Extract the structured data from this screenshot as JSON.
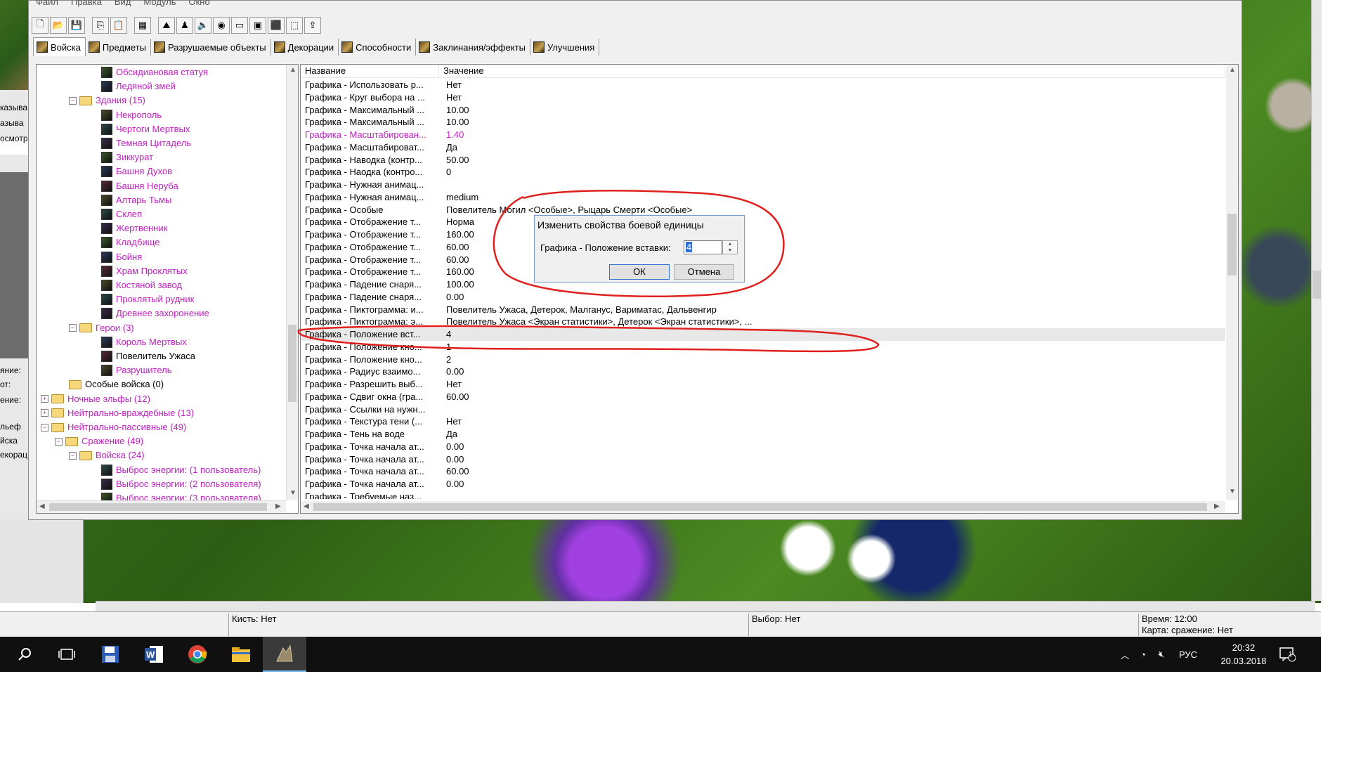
{
  "menu": [
    "Файл",
    "Правка",
    "Вид",
    "Модуль",
    "Окно"
  ],
  "toolbar_icons": [
    "new-file-icon",
    "open-folder-icon",
    "save-icon",
    "copy-icon",
    "paste-icon",
    "select-icon",
    "terrain-icon",
    "unit-icon",
    "sound-icon",
    "object-editor-icon",
    "trigger-icon",
    "import-icon",
    "script-icon",
    "ai-icon",
    "test-map-icon"
  ],
  "tabs": [
    "Войска",
    "Предметы",
    "Разрушаемые объекты",
    "Декорации",
    "Способности",
    "Заклинания/эффекты",
    "Улучшения"
  ],
  "tree": [
    {
      "label": "Обсидиановая статуя",
      "level": 3,
      "kind": "unit",
      "color": "mag"
    },
    {
      "label": "Ледяной змей",
      "level": 3,
      "kind": "unit",
      "color": "mag"
    },
    {
      "label": "Здания (15)",
      "level": 2,
      "kind": "folder",
      "color": "mag",
      "pm": "−"
    },
    {
      "label": "Некрополь",
      "level": 3,
      "kind": "unit",
      "color": "mag"
    },
    {
      "label": "Чертоги Мертвых",
      "level": 3,
      "kind": "unit",
      "color": "mag"
    },
    {
      "label": "Темная Цитадель",
      "level": 3,
      "kind": "unit",
      "color": "mag"
    },
    {
      "label": "Зиккурат",
      "level": 3,
      "kind": "unit",
      "color": "mag"
    },
    {
      "label": "Башня Духов",
      "level": 3,
      "kind": "unit",
      "color": "mag"
    },
    {
      "label": "Башня Неруба",
      "level": 3,
      "kind": "unit",
      "color": "mag"
    },
    {
      "label": "Алтарь Тьмы",
      "level": 3,
      "kind": "unit",
      "color": "mag"
    },
    {
      "label": "Склеп",
      "level": 3,
      "kind": "unit",
      "color": "mag"
    },
    {
      "label": "Жертвенник",
      "level": 3,
      "kind": "unit",
      "color": "mag"
    },
    {
      "label": "Кладбище",
      "level": 3,
      "kind": "unit",
      "color": "mag"
    },
    {
      "label": "Бойня",
      "level": 3,
      "kind": "unit",
      "color": "mag"
    },
    {
      "label": "Храм Проклятых",
      "level": 3,
      "kind": "unit",
      "color": "mag"
    },
    {
      "label": "Костяной завод",
      "level": 3,
      "kind": "unit",
      "color": "mag"
    },
    {
      "label": "Проклятый рудник",
      "level": 3,
      "kind": "unit",
      "color": "mag"
    },
    {
      "label": "Древнее захоронение",
      "level": 3,
      "kind": "unit",
      "color": "mag"
    },
    {
      "label": "Герои (3)",
      "level": 2,
      "kind": "folder",
      "color": "mag",
      "pm": "−"
    },
    {
      "label": "Король Мертвых",
      "level": 3,
      "kind": "unit",
      "color": "mag"
    },
    {
      "label": "Повелитель Ужаса",
      "level": 3,
      "kind": "unit",
      "color": "blk"
    },
    {
      "label": "Разрушитель",
      "level": 3,
      "kind": "unit",
      "color": "mag"
    },
    {
      "label": "Особые войска (0)",
      "level": 2,
      "kind": "folder",
      "color": "blk"
    },
    {
      "label": "Ночные эльфы (12)",
      "level": 0,
      "kind": "folder",
      "color": "mag",
      "pm": "+"
    },
    {
      "label": "Нейтрально-враждебные (13)",
      "level": 0,
      "kind": "folder",
      "color": "mag",
      "pm": "+"
    },
    {
      "label": "Нейтрально-пассивные (49)",
      "level": 0,
      "kind": "folder",
      "color": "mag",
      "pm": "−"
    },
    {
      "label": "Сражение (49)",
      "level": 1,
      "kind": "folder",
      "color": "mag",
      "pm": "−"
    },
    {
      "label": "Войска (24)",
      "level": 2,
      "kind": "folder",
      "color": "mag",
      "pm": "−"
    },
    {
      "label": "Выброс энергии: (1 пользователь)",
      "level": 3,
      "kind": "unit",
      "color": "mag"
    },
    {
      "label": "Выброс энергии: (2 пользователя)",
      "level": 3,
      "kind": "unit",
      "color": "mag"
    },
    {
      "label": "Выброс энергии: (3 пользователя)",
      "level": 3,
      "kind": "unit",
      "color": "mag"
    }
  ],
  "list": {
    "headers": [
      "Название",
      "Значение"
    ],
    "rows": [
      {
        "name": "Графика - Использовать р...",
        "value": "Нет"
      },
      {
        "name": "Графика - Круг выбора на ...",
        "value": "Нет"
      },
      {
        "name": "Графика - Максимальный ...",
        "value": "10.00"
      },
      {
        "name": "Графика - Максимальный ...",
        "value": "10.00"
      },
      {
        "name": "Графика - Масштабирован...",
        "value": "1.40",
        "mag": true
      },
      {
        "name": "Графика - Масштабироват...",
        "value": "Да"
      },
      {
        "name": "Графика - Наводка (контр...",
        "value": "50.00"
      },
      {
        "name": "Графика - Наодка (контро...",
        "value": "0"
      },
      {
        "name": "Графика - Нужная анимац...",
        "value": ""
      },
      {
        "name": "Графика - Нужная анимац...",
        "value": "medium"
      },
      {
        "name": "Графика - Особые",
        "value": "Повелитель Могил <Особые>, Рыцарь Смерти <Особые>"
      },
      {
        "name": "Графика - Отображение т...",
        "value": "Норма"
      },
      {
        "name": "Графика - Отображение т...",
        "value": "160.00"
      },
      {
        "name": "Графика - Отображение т...",
        "value": "60.00"
      },
      {
        "name": "Графика - Отображение т...",
        "value": "60.00"
      },
      {
        "name": "Графика - Отображение т...",
        "value": "160.00"
      },
      {
        "name": "Графика - Падение снаря...",
        "value": "100.00"
      },
      {
        "name": "Графика - Падение снаря...",
        "value": "0.00"
      },
      {
        "name": "Графика - Пиктограмма: и...",
        "value": "Повелитель Ужаса, Детерок, Малганус, Вариматас, Дальвенгир"
      },
      {
        "name": "Графика - Пиктограмма: э...",
        "value": "Повелитель Ужаса <Экран статистики>, Детерок <Экран статистики>, ..."
      },
      {
        "name": "Графика - Положение вст...",
        "value": "4",
        "selected": true
      },
      {
        "name": "Графика - Положение кно...",
        "value": "1"
      },
      {
        "name": "Графика - Положение кно...",
        "value": "2"
      },
      {
        "name": "Графика - Радиус взаимо...",
        "value": "0.00"
      },
      {
        "name": "Графика - Разрешить выб...",
        "value": "Нет"
      },
      {
        "name": "Графика - Сдвиг окна (гра...",
        "value": "60.00"
      },
      {
        "name": "Графика - Ссылки на нужн...",
        "value": ""
      },
      {
        "name": "Графика - Текстура тени (...",
        "value": "Нет"
      },
      {
        "name": "Графика - Тень на воде",
        "value": "Да"
      },
      {
        "name": "Графика - Точка начала ат...",
        "value": "0.00"
      },
      {
        "name": "Графика - Точка начала ат...",
        "value": "0.00"
      },
      {
        "name": "Графика - Точка начала ат...",
        "value": "60.00"
      },
      {
        "name": "Графика - Точка начала ат...",
        "value": "0.00"
      },
      {
        "name": "Графика - Требуемые наз...",
        "value": ""
      }
    ]
  },
  "dialog": {
    "title": "Изменить свойства боевой единицы",
    "field_label": "Графика - Положение вставки:",
    "field_value": "4",
    "ok": "ОК",
    "cancel": "Отмена"
  },
  "left_fragments": [
    "казыва",
    "азыва",
    "осмотр",
    "яние:",
    "от:",
    "ение:",
    "льеф",
    "йска",
    "екорац"
  ],
  "status": {
    "brush": "Кисть: Нет",
    "selection": "Выбор: Нет",
    "time": "Время: 12:00",
    "map": "Карта: сражение: Нет"
  },
  "taskbar": {
    "apps": [
      "search-icon",
      "task-view-icon",
      "floppy-app-icon",
      "word-icon",
      "chrome-icon",
      "explorer-icon",
      "world-editor-icon"
    ],
    "lang": "РУС",
    "time": "20:32",
    "date": "20.03.2018",
    "notif_count": "1"
  }
}
